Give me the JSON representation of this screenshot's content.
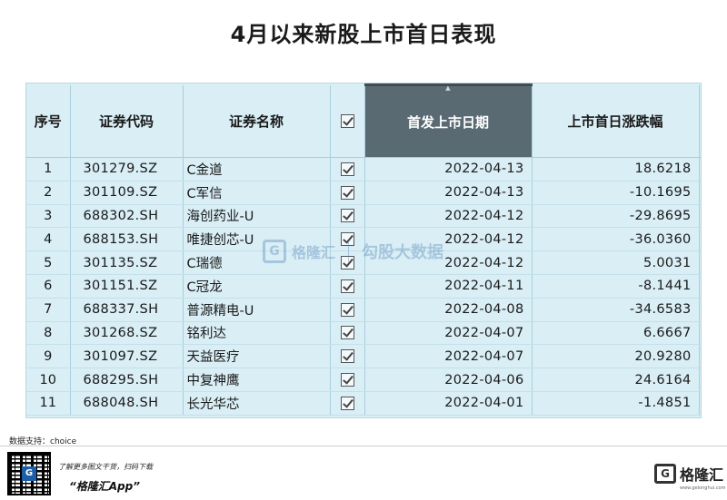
{
  "title": "4月以来新股上市首日表现",
  "table": {
    "headers": [
      "序号",
      "证券代码",
      "证券名称",
      "首发上市日期",
      "上市首日涨跌幅"
    ],
    "rows": [
      {
        "no": "1",
        "code": "301279.SZ",
        "name": "C金道",
        "date": "2022-04-13",
        "pct": "18.6218"
      },
      {
        "no": "2",
        "code": "301109.SZ",
        "name": "C军信",
        "date": "2022-04-13",
        "pct": "-10.1695"
      },
      {
        "no": "3",
        "code": "688302.SH",
        "name": "海创药业-U",
        "date": "2022-04-12",
        "pct": "-29.8695"
      },
      {
        "no": "4",
        "code": "688153.SH",
        "name": "唯捷创芯-U",
        "date": "2022-04-12",
        "pct": "-36.0360"
      },
      {
        "no": "5",
        "code": "301135.SZ",
        "name": "C瑞德",
        "date": "2022-04-12",
        "pct": "5.0031"
      },
      {
        "no": "6",
        "code": "301151.SZ",
        "name": "C冠龙",
        "date": "2022-04-11",
        "pct": "-8.1441"
      },
      {
        "no": "7",
        "code": "688337.SH",
        "name": "普源精电-U",
        "date": "2022-04-08",
        "pct": "-34.6583"
      },
      {
        "no": "8",
        "code": "301268.SZ",
        "name": "铭利达",
        "date": "2022-04-07",
        "pct": "6.6667"
      },
      {
        "no": "9",
        "code": "301097.SZ",
        "name": "天益医疗",
        "date": "2022-04-07",
        "pct": "20.9280"
      },
      {
        "no": "10",
        "code": "688295.SH",
        "name": "中复神鹰",
        "date": "2022-04-06",
        "pct": "24.6164"
      },
      {
        "no": "11",
        "code": "688048.SH",
        "name": "长光华芯",
        "date": "2022-04-01",
        "pct": "-1.4851"
      }
    ]
  },
  "watermark": {
    "brand": "格隆汇",
    "text": "勾股大数据"
  },
  "footer": {
    "source": "数据支持：choice",
    "promo_line": "了解更多图文干货，扫码下载",
    "app_name": "“格隆汇App”",
    "brand_name": "格隆汇",
    "brand_url": "www.gelonghui.com",
    "qr_logo": "G"
  },
  "colors": {
    "table_bg": "#d9eef5",
    "sorted_header_bg": "#5a6a72",
    "border": "#a9cfdc"
  },
  "icons": {
    "checkbox": "checkbox-checked-icon",
    "sort": "sort-caret-icon"
  }
}
